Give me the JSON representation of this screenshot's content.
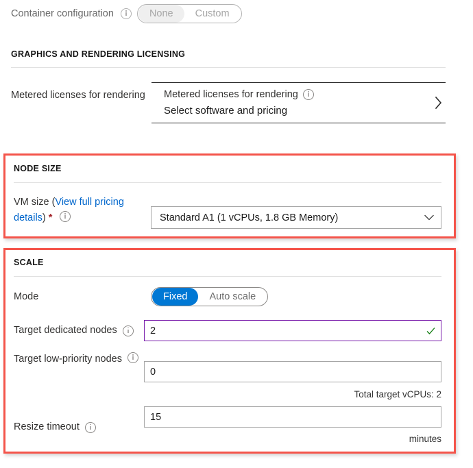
{
  "container_config": {
    "label": "Container configuration",
    "info_icon": "info-icon",
    "options": [
      "None",
      "Custom"
    ],
    "selected": "None",
    "disabled": true
  },
  "graphics_section": {
    "title": "GRAPHICS AND RENDERING LICENSING",
    "metered": {
      "label": "Metered licenses for rendering",
      "card_title": "Metered licenses for rendering",
      "card_subtitle": "Select software and pricing",
      "info_icon": "info-icon",
      "chevron_icon": "chevron-right-icon"
    }
  },
  "node_size_section": {
    "title": "NODE SIZE",
    "vm_size": {
      "label_prefix": "VM size (",
      "link_text": "View full pricing details",
      "label_suffix": ")",
      "required_marker": "*",
      "info_icon": "info-icon",
      "selected": "Standard A1 (1 vCPUs, 1.8 GB Memory)",
      "chevron_icon": "chevron-down-icon"
    },
    "highlight_color": "#f4544a"
  },
  "scale_section": {
    "title": "SCALE",
    "mode": {
      "label": "Mode",
      "options": [
        "Fixed",
        "Auto scale"
      ],
      "selected": "Fixed",
      "selected_color": "#0078d4"
    },
    "target_dedicated_nodes": {
      "label": "Target dedicated nodes",
      "info_icon": "info-icon",
      "value": "2",
      "focused": true,
      "focus_border_color": "#7719aa",
      "valid_icon": "checkmark-icon",
      "valid_color": "#107c10"
    },
    "target_low_priority_nodes": {
      "label": "Target low-priority nodes",
      "info_icon": "info-icon",
      "value": "0",
      "footnote": "Total target vCPUs: 2"
    },
    "resize_timeout": {
      "label": "Resize timeout",
      "info_icon": "info-icon",
      "value": "15",
      "unit": "minutes"
    },
    "highlight_color": "#f4544a"
  }
}
